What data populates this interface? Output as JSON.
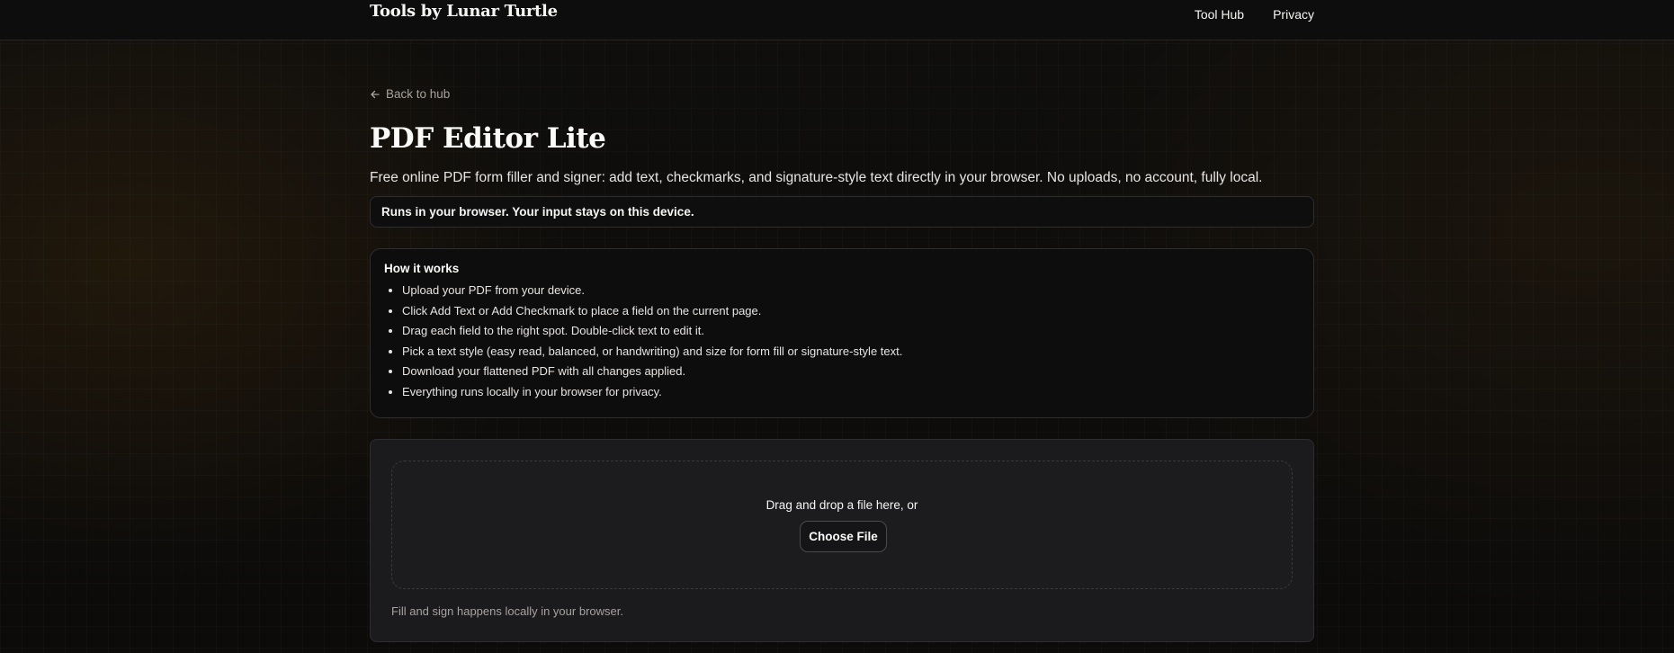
{
  "header": {
    "brand": "Tools by Lunar Turtle",
    "nav": [
      "Tool Hub",
      "Privacy"
    ]
  },
  "back_link": {
    "label": "Back to hub",
    "icon": "arrow-left-icon"
  },
  "page": {
    "title": "PDF Editor Lite",
    "subtitle": "Free online PDF form filler and signer: add text, checkmarks, and signature-style text directly in your browser. No uploads, no account, fully local.",
    "notice": "Runs in your browser. Your input stays on this device."
  },
  "how_it_works": {
    "heading": "How it works",
    "steps": [
      "Upload your PDF from your device.",
      "Click Add Text or Add Checkmark to place a field on the current page.",
      "Drag each field to the right spot. Double-click text to edit it.",
      "Pick a text style (easy read, balanced, or handwriting) and size for form fill or signature-style text.",
      "Download your flattened PDF with all changes applied.",
      "Everything runs locally in your browser for privacy."
    ]
  },
  "upload": {
    "drop_text": "Drag and drop a file here, or",
    "button_label": "Choose File",
    "note": "Fill and sign happens locally in your browser."
  },
  "colors": {
    "background": "#0e0d0b",
    "card": "#1b1b1d",
    "border": "#2e2e2e",
    "text": "#e7e5e4",
    "muted": "#a8a29e"
  }
}
